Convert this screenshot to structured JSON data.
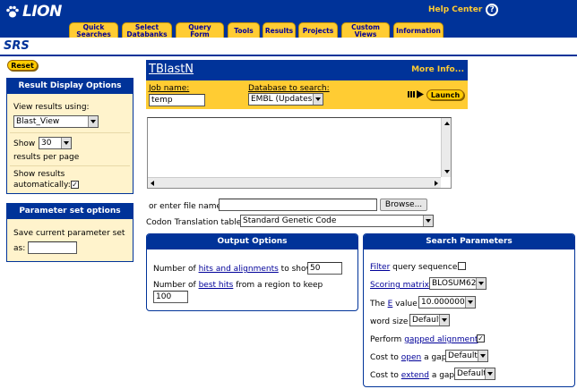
{
  "brand": {
    "logo_text": "LION",
    "app_name": "SRS"
  },
  "header": {
    "help_label": "Help Center",
    "tabs": [
      {
        "line1": "Quick",
        "line2": "Searches"
      },
      {
        "line1": "Select",
        "line2": "Databanks"
      },
      {
        "line1": "Query",
        "line2": "Form"
      },
      {
        "line1": "Tools",
        "line2": ""
      },
      {
        "line1": "Results",
        "line2": ""
      },
      {
        "line1": "Projects",
        "line2": ""
      },
      {
        "line1": "Custom",
        "line2": "Views"
      },
      {
        "line1": "Information",
        "line2": ""
      }
    ]
  },
  "sidebar": {
    "reset_label": "Reset",
    "display_title": "Result Display Options",
    "view_label": "View results using:",
    "view_value": "Blast_View",
    "show_label": "Show",
    "show_value": "30",
    "per_page_label": "results per page",
    "auto_label_1": "Show results",
    "auto_label_2": "automatically:",
    "auto_checked": "✓",
    "param_title": "Parameter set options",
    "save_label_1": "Save current parameter set",
    "save_label_2": "as:",
    "save_value": ""
  },
  "tool": {
    "title": "TBlastN",
    "more_info": "More Info...",
    "job_label": "Job name:",
    "job_value": "temp",
    "db_label": "Database to search:",
    "db_value": "EMBL (Updates)",
    "launch_label": "Launch",
    "file_label": "or enter file name",
    "file_value": "",
    "browse_label": "Browse...",
    "codon_label": "Codon Translation table",
    "codon_value": "Standard Genetic Code"
  },
  "output_options": {
    "title": "Output Options",
    "hits_pre": "Number of ",
    "hits_link": "hits and alignments",
    "hits_post": " to show",
    "hits_value": "50",
    "best_pre": "Number of ",
    "best_link": "best hits",
    "best_post": " from a region to keep",
    "best_value": "100"
  },
  "search_params": {
    "title": "Search Parameters",
    "filter_link": "Filter",
    "filter_post": " query sequence",
    "matrix_link": "Scoring matrix",
    "matrix_value": "BLOSUM62",
    "e_pre": "The ",
    "e_link": "E",
    "e_post": " value",
    "e_value": "10.000000",
    "word_label": "word size",
    "word_value": "Default",
    "gapped_pre": "Perform ",
    "gapped_link": "gapped alignment",
    "gapped_checked": "✓",
    "open_pre": "Cost to ",
    "open_link": "open",
    "open_post": " a gap",
    "open_value": "Default",
    "extend_pre": "Cost to ",
    "extend_link": "extend",
    "extend_post": " a gap",
    "extend_value": "Default"
  }
}
